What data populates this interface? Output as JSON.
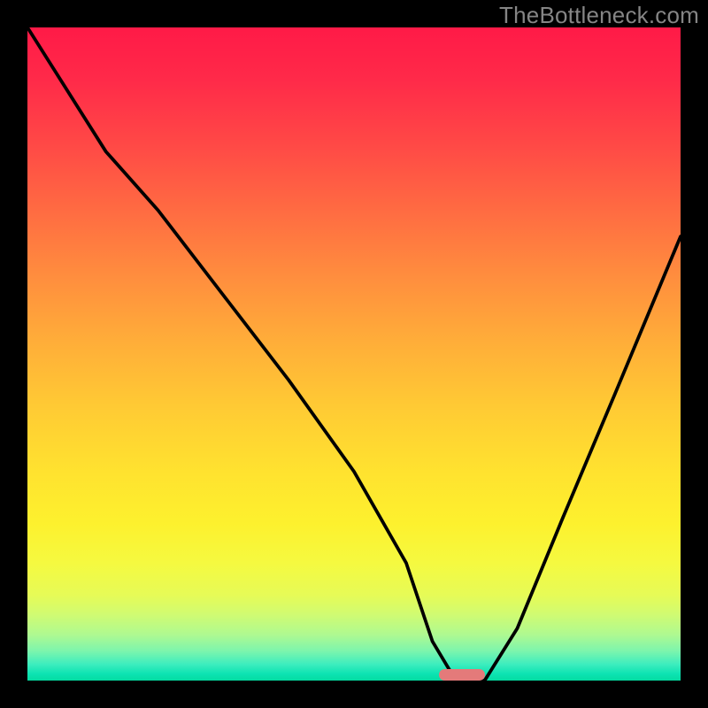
{
  "watermark": "TheBottleneck.com",
  "chart_data": {
    "type": "line",
    "title": "",
    "xlabel": "",
    "ylabel": "",
    "xlim": [
      0,
      100
    ],
    "ylim": [
      0,
      100
    ],
    "x": [
      0,
      12,
      20,
      30,
      40,
      50,
      58,
      62,
      65,
      68,
      70,
      75,
      82,
      90,
      100
    ],
    "values": [
      100,
      81,
      72,
      59,
      46,
      32,
      18,
      6,
      1,
      0,
      0,
      8,
      25,
      44,
      68
    ],
    "optimal_range_x": [
      63,
      70
    ],
    "marker_color": "#e47a7a",
    "gradient_stops": [
      {
        "pos": 0.0,
        "color": "#ff1a47"
      },
      {
        "pos": 0.5,
        "color": "#ffc634"
      },
      {
        "pos": 0.8,
        "color": "#f7f934"
      },
      {
        "pos": 1.0,
        "color": "#04dba1"
      }
    ]
  }
}
